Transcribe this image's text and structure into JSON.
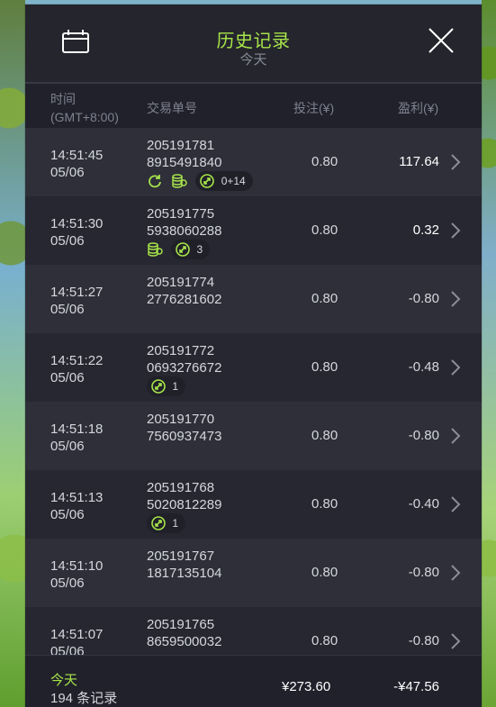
{
  "header": {
    "title": "历史记录",
    "subtitle": "今天",
    "calendar_icon": "calendar-icon",
    "close_icon": "close-icon"
  },
  "columns": {
    "time_line1": "时间",
    "time_line2": "(GMT+8:00)",
    "order": "交易单号",
    "bet": "投注(¥)",
    "profit": "盈利(¥)"
  },
  "rows": [
    {
      "time": "14:51:45",
      "date": "05/06",
      "order_line1": "205191781",
      "order_line2": "8915491840",
      "bet": "0.80",
      "profit": "117.64",
      "icons": [
        {
          "type": "refresh-icon"
        },
        {
          "type": "coins-icon"
        },
        {
          "type": "spin-icon",
          "label": "0+14"
        }
      ]
    },
    {
      "time": "14:51:30",
      "date": "05/06",
      "order_line1": "205191775",
      "order_line2": "5938060288",
      "bet": "0.80",
      "profit": "0.32",
      "icons": [
        {
          "type": "coins-icon"
        },
        {
          "type": "spin-icon",
          "label": "3"
        }
      ]
    },
    {
      "time": "14:51:27",
      "date": "05/06",
      "order_line1": "205191774",
      "order_line2": "2776281602",
      "bet": "0.80",
      "profit": "-0.80",
      "icons": []
    },
    {
      "time": "14:51:22",
      "date": "05/06",
      "order_line1": "205191772",
      "order_line2": "0693276672",
      "bet": "0.80",
      "profit": "-0.48",
      "icons": [
        {
          "type": "spin-icon",
          "label": "1"
        }
      ]
    },
    {
      "time": "14:51:18",
      "date": "05/06",
      "order_line1": "205191770",
      "order_line2": "7560937473",
      "bet": "0.80",
      "profit": "-0.80",
      "icons": []
    },
    {
      "time": "14:51:13",
      "date": "05/06",
      "order_line1": "205191768",
      "order_line2": "5020812289",
      "bet": "0.80",
      "profit": "-0.40",
      "icons": [
        {
          "type": "spin-icon",
          "label": "1"
        }
      ]
    },
    {
      "time": "14:51:10",
      "date": "05/06",
      "order_line1": "205191767",
      "order_line2": "1817135104",
      "bet": "0.80",
      "profit": "-0.80",
      "icons": []
    },
    {
      "time": "14:51:07",
      "date": "05/06",
      "order_line1": "205191765",
      "order_line2": "8659500032",
      "bet": "0.80",
      "profit": "-0.80",
      "icons": []
    }
  ],
  "footer": {
    "today": "今天",
    "count": "194 条记录",
    "bet_total": "¥273.60",
    "profit_total": "-¥47.56"
  },
  "colors": {
    "accent": "#a7e44a",
    "panel": "#262730",
    "row_alt": "#2e2f39",
    "header": "#20212a"
  }
}
